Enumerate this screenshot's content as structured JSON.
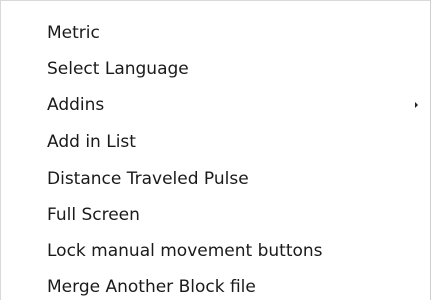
{
  "menu": {
    "items": [
      {
        "label": "Metric",
        "has_submenu": false
      },
      {
        "label": "Select Language",
        "has_submenu": false
      },
      {
        "label": "Addins",
        "has_submenu": true
      },
      {
        "label": "Add in List",
        "has_submenu": false
      },
      {
        "label": "Distance Traveled Pulse",
        "has_submenu": false
      },
      {
        "label": "Full Screen",
        "has_submenu": false
      },
      {
        "label": "Lock manual movement buttons",
        "has_submenu": false
      },
      {
        "label": "Merge Another Block file",
        "has_submenu": false
      }
    ]
  }
}
